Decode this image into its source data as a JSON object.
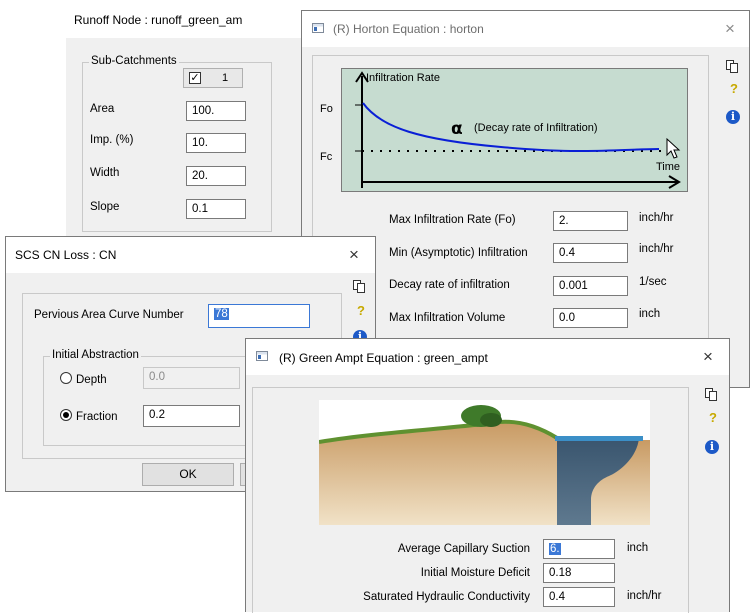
{
  "runoff": {
    "title": "Runoff Node : runoff_green_am",
    "group_label": "Sub-Catchments",
    "index": "1",
    "fields": [
      {
        "label": "Area",
        "value": "100."
      },
      {
        "label": "Imp. (%)",
        "value": "10."
      },
      {
        "label": "Width",
        "value": "20."
      },
      {
        "label": "Slope",
        "value": "0.1"
      }
    ]
  },
  "horton": {
    "title": "(R) Horton Equation : horton",
    "diagram": {
      "y_axis": "Infiltration Rate",
      "fo": "Fo",
      "fc": "Fc",
      "time": "Time",
      "alpha": "α",
      "decay_note": "(Decay rate of Infiltration)"
    },
    "params": [
      {
        "label": "Max Infiltration Rate (Fo)",
        "value": "2.",
        "unit": "inch/hr"
      },
      {
        "label": "Min (Asymptotic) Infiltration",
        "value": "0.4",
        "unit": "inch/hr"
      },
      {
        "label": "Decay rate of infiltration",
        "value": "0.001",
        "unit": "1/sec"
      },
      {
        "label": "Max Infiltration Volume",
        "value": "0.0",
        "unit": "inch"
      }
    ]
  },
  "scs": {
    "title": "SCS CN Loss : CN",
    "cn_label": "Pervious Area Curve Number",
    "cn_value": "78",
    "group_label": "Initial Abstraction",
    "depth_label": "Depth",
    "depth_value": "0.0",
    "fraction_label": "Fraction",
    "fraction_value": "0.2",
    "selected_option": "Fraction",
    "ok_label": "OK"
  },
  "green_ampt": {
    "title": "(R) Green Ampt Equation : green_ampt",
    "params": [
      {
        "label": "Average Capillary Suction",
        "value": "6.",
        "unit": "inch"
      },
      {
        "label": "Initial Moisture Deficit",
        "value": "0.18",
        "unit": ""
      },
      {
        "label": "Saturated Hydraulic Conductivity",
        "value": "0.4",
        "unit": "inch/hr"
      }
    ]
  },
  "icons": {
    "close": "×",
    "help": "?",
    "info": "i",
    "copy": "copy-icon"
  },
  "colors": {
    "curve": "#0a1fd6",
    "diagram_bg": "#c6dcd0",
    "selection": "#3b78d6",
    "info": "#1c59c7"
  }
}
